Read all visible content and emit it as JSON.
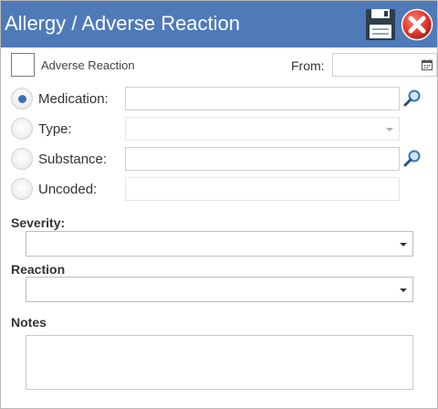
{
  "window": {
    "title": "Allergy / Adverse Reaction",
    "save_icon": "floppy-disk-icon",
    "close_icon": "close-circle-icon"
  },
  "adverse_reaction": {
    "label": "Adverse Reaction",
    "checked": false
  },
  "from": {
    "label": "From:",
    "value": "",
    "icon": "calendar-icon"
  },
  "entry_mode": {
    "options": [
      {
        "label": "Medication:",
        "selected": true,
        "value": "",
        "lookup_icon": "search-icon"
      },
      {
        "label": "Type:",
        "selected": false,
        "value": "",
        "disabled": true
      },
      {
        "label": "Substance:",
        "selected": false,
        "value": "",
        "lookup_icon": "search-icon"
      },
      {
        "label": "Uncoded:",
        "selected": false,
        "value": "",
        "disabled": true
      }
    ]
  },
  "severity": {
    "label": "Severity:",
    "value": ""
  },
  "reaction": {
    "label": "Reaction",
    "value": ""
  },
  "notes": {
    "label": "Notes",
    "value": ""
  },
  "colors": {
    "titlebar": "#4f7ab8",
    "accent_blue": "#3c6fb4",
    "close_red": "#d9312b"
  }
}
